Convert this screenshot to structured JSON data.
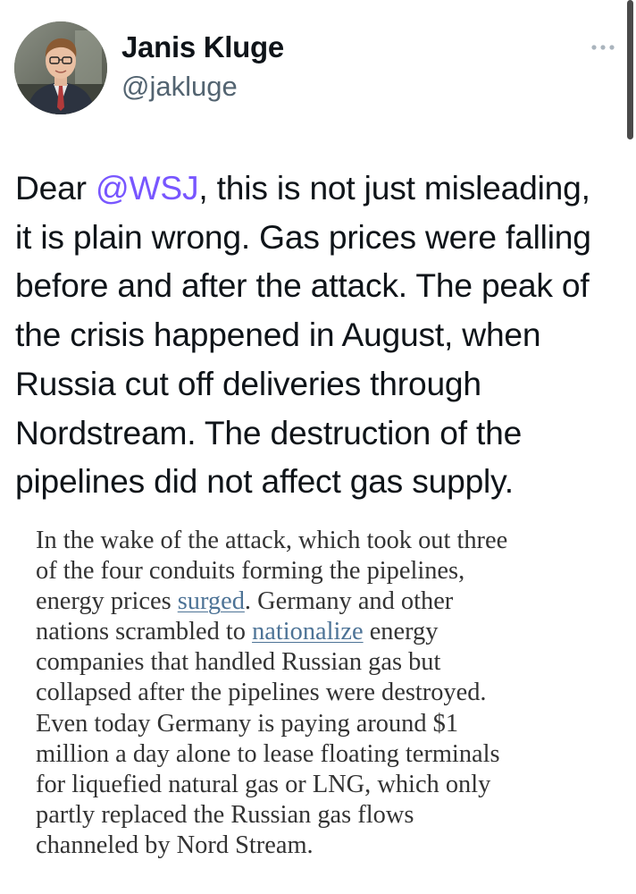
{
  "author": {
    "name": "Janis Kluge",
    "handle": "@jakluge"
  },
  "icons": {
    "avatar": "profile-photo",
    "more": "more-horizontal-icon"
  },
  "colors": {
    "mention": "#7856ff",
    "quote_link": "#4d7396",
    "handle": "#536471"
  },
  "tweet": {
    "lines": [
      {
        "pre": "Dear ",
        "mention": "@WSJ",
        "post": ", this is not just misleading,"
      },
      {
        "text": "it is plain wrong. Gas prices were falling"
      },
      {
        "text": "before and after the attack. The peak of"
      },
      {
        "text": "the crisis happened in August, when"
      },
      {
        "text": "Russia cut off deliveries through"
      },
      {
        "text": "Nordstream. The destruction of the"
      },
      {
        "text": "pipelines did not affect gas supply."
      }
    ]
  },
  "quote": {
    "lines": [
      {
        "text": "In the wake of the attack, which took out three"
      },
      {
        "text": "of the four conduits forming the pipelines,"
      },
      {
        "pre": "energy prices ",
        "link": "surged",
        "post": ". Germany and other"
      },
      {
        "pre": "nations scrambled to ",
        "link": "nationalize",
        "post": " energy"
      },
      {
        "text": "companies that handled Russian gas but"
      },
      {
        "text": "collapsed after the pipelines were destroyed."
      },
      {
        "text": "Even today Germany is paying around $1"
      },
      {
        "text": "million a day alone to lease floating terminals"
      },
      {
        "text": "for liquefied natural gas or LNG, which only"
      },
      {
        "text": "partly replaced the Russian gas flows"
      },
      {
        "text": "channeled by Nord Stream."
      }
    ]
  }
}
